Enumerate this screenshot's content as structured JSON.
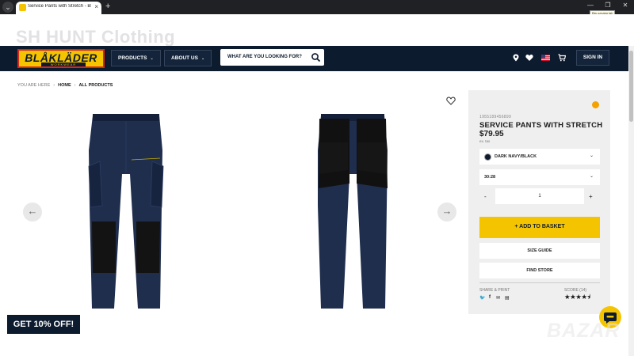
{
  "browser": {
    "tab_title": "Service Pants with Stretch - Blåk",
    "new_tab": "+",
    "tab_close": "×",
    "window_controls": [
      "—",
      "❐",
      "✕"
    ],
    "tooltip": "Bla oznaka tab"
  },
  "site_name": "SH HUNT Clothing",
  "logo": {
    "main": "BLÅKLÄDER",
    "sub": "WORKWEAR"
  },
  "nav": {
    "products": "PRODUCTS",
    "about": "ABOUT US",
    "search_placeholder": "WHAT ARE YOU LOOKING FOR?",
    "sign_in": "SIGN IN",
    "icons": [
      "location-icon",
      "heart-icon",
      "flag-us-icon",
      "cart-icon"
    ]
  },
  "breadcrumb": {
    "prefix": "YOU ARE HERE",
    "home": "HOME",
    "current": "ALL PRODUCTS"
  },
  "gallery": {
    "prev": "←",
    "next": "→"
  },
  "product": {
    "sku": "1955189456899",
    "title": "SERVICE PANTS WITH STRETCH",
    "price": "$79.95",
    "vat": "ex. tax",
    "color": "DARK NAVY/BLACK",
    "size": "30:28",
    "qty_minus": "-",
    "qty": "1",
    "qty_plus": "+",
    "add_to_basket": "+ ADD TO BASKET",
    "size_guide": "SIZE GUIDE",
    "find_store": "FIND STORE",
    "share_label": "SHARE & PRINT",
    "score_label": "SCORE (14)",
    "share_icons": [
      "twitter-icon",
      "facebook-icon",
      "mail-icon",
      "print-icon"
    ],
    "rating": 4.5,
    "stars": "★★★★⯨",
    "stock_color": "#f5a100"
  },
  "promo": "GET 10% OFF!",
  "watermark": "BAZAR",
  "colors": {
    "navy": "#0d1b2e",
    "yellow": "#f5c400",
    "red": "#d8261b"
  }
}
